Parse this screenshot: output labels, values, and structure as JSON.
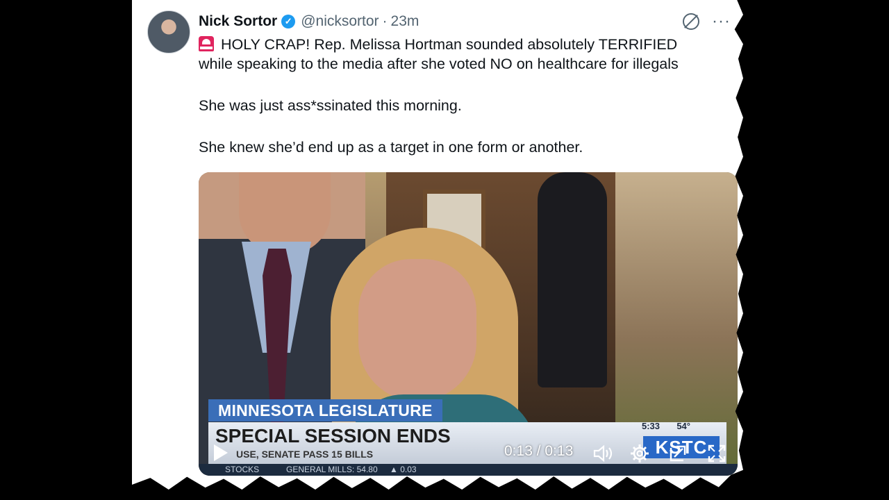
{
  "tweet": {
    "author_name": "Nick Sortor",
    "handle": "@nicksortor",
    "separator": "·",
    "time": "23m",
    "lines": [
      "HOLY CRAP! Rep. Melissa Hortman sounded absolutely TERRIFIED",
      "while speaking to the media after she voted NO on healthcare for illegals",
      "She was just ass*ssinated this morning.",
      "She knew she’d end up as a target in one form or another."
    ]
  },
  "video": {
    "lower_third": {
      "title": "MINNESOTA LEGISLATURE",
      "headline": "SPECIAL SESSION ENDS",
      "sub": "USE, SENATE PASS 15 BILLS",
      "clock": "5:33",
      "temp": "54°",
      "station": "KSTC"
    },
    "ticker": {
      "label": "STOCKS",
      "item": "GENERAL MILLS: 54.80",
      "change": "▲ 0.03"
    },
    "timecode": "0:13 / 0:13"
  },
  "colors": {
    "verified_badge": "#1d9bf0",
    "lower_title_bg": "#3a6eb8",
    "station_bg": "#2868c7"
  },
  "icons": {
    "verified": "verified-badge-icon",
    "grok": "grok-icon",
    "more": "more-icon",
    "siren": "siren-icon",
    "play": "play-icon",
    "volume": "volume-icon",
    "settings": "gear-icon",
    "pip": "pip-icon",
    "fullscreen": "fullscreen-icon"
  }
}
